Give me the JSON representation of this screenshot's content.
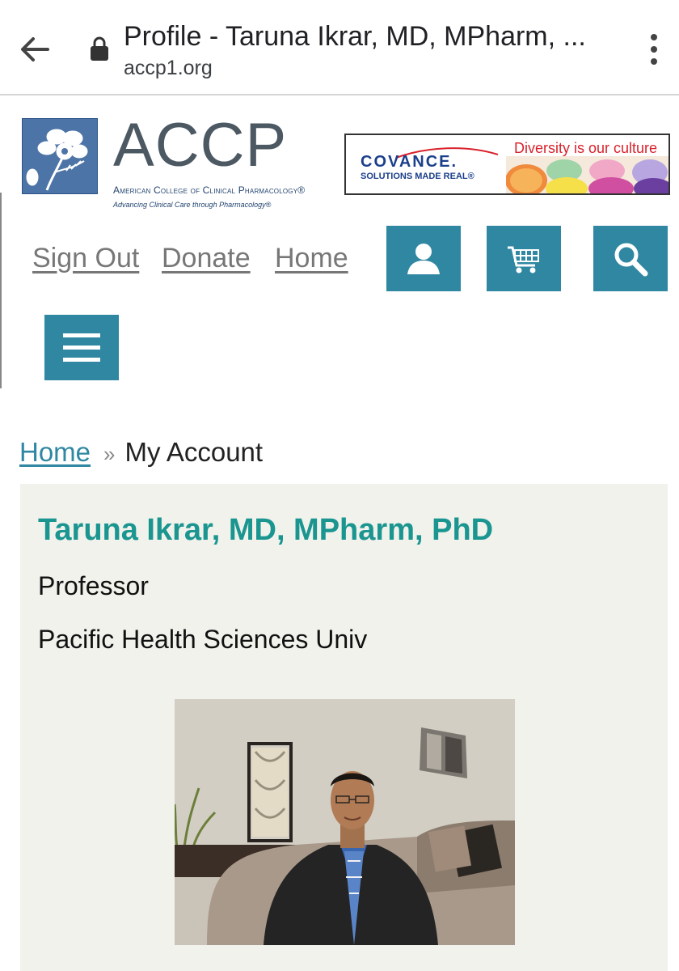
{
  "browser": {
    "tab_title": "Profile - Taruna Ikrar, MD, MPharm, ...",
    "url": "accp1.org",
    "icons": {
      "back": "arrow-left-icon",
      "lock": "lock-icon",
      "menu": "more-vert-icon"
    }
  },
  "header": {
    "logo_word": "ACCP",
    "logo_subtitle": "American College of Clinical Pharmacology®",
    "logo_tagline": "Advancing Clinical Care through Pharmacology®",
    "logo_reg": "®",
    "ad": {
      "brand": "COVANCE.",
      "brand_sub": "SOLUTIONS MADE REAL®",
      "tagline": "Diversity is our culture"
    }
  },
  "nav": {
    "sign_out": "Sign Out",
    "donate": "Donate",
    "home": "Home",
    "icons": [
      "user-icon",
      "cart-icon",
      "search-icon",
      "hamburger-menu-icon"
    ]
  },
  "breadcrumb": {
    "home": "Home",
    "separator": "»",
    "current": "My Account"
  },
  "profile": {
    "name": "Taruna Ikrar, MD, MPharm, PhD",
    "position": "Professor",
    "organization": "Pacific Health Sciences Univ"
  },
  "colors": {
    "accent": "#2f87a2",
    "name_color": "#1a9590",
    "card_bg": "#f1f2ec",
    "logo_blue": "#4d74a6"
  }
}
